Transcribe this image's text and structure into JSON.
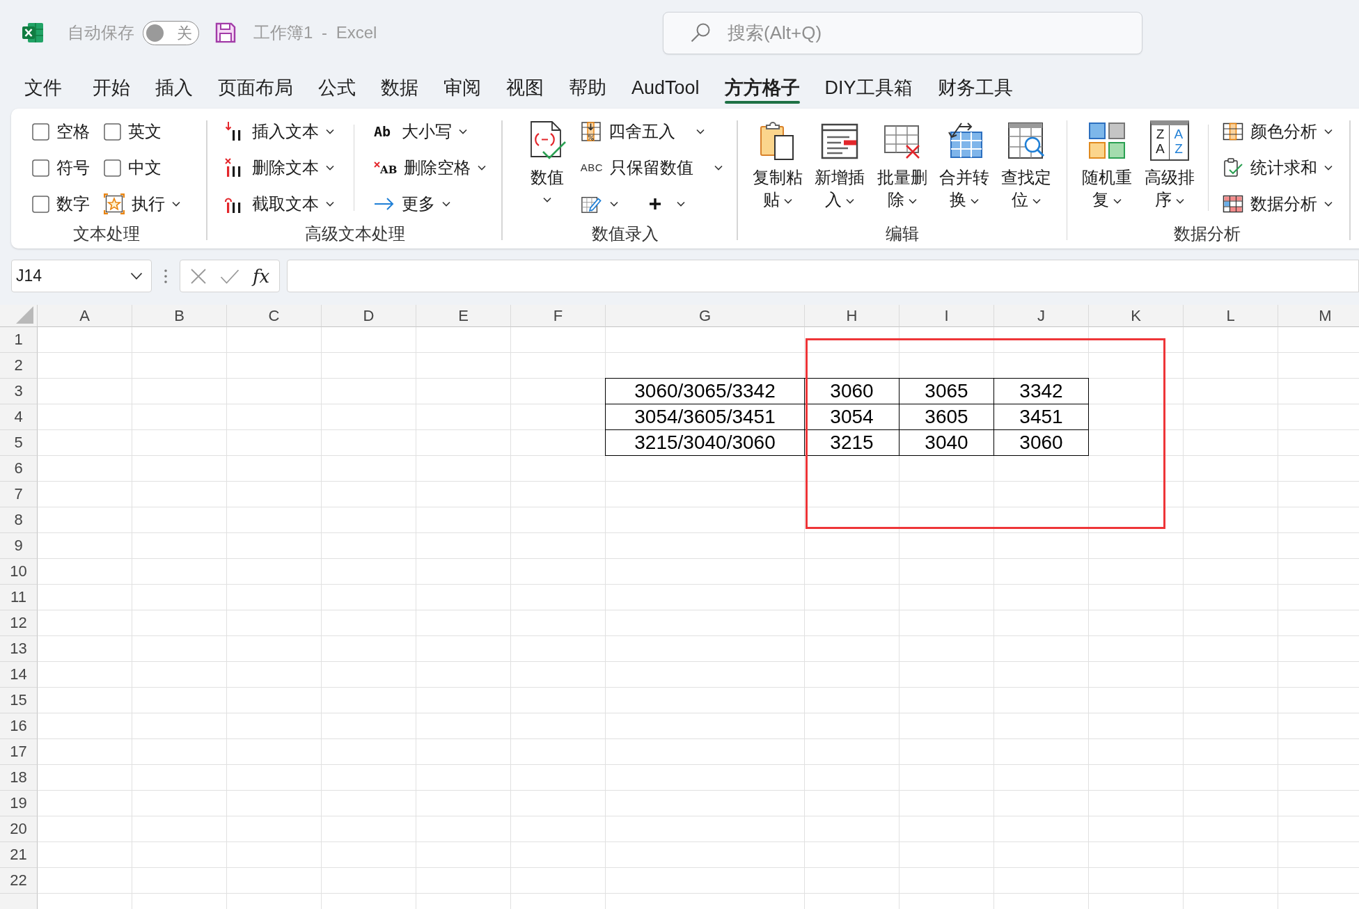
{
  "title_bar": {
    "autosave_label": "自动保存",
    "autosave_toggle": {
      "on": false,
      "label": "关"
    },
    "title": "工作簿1 - Excel",
    "search": {
      "placeholder": "搜索(Alt+Q)"
    }
  },
  "menu_tabs": [
    {
      "label": "文件",
      "selected": false
    },
    {
      "label": "开始",
      "selected": false
    },
    {
      "label": "插入",
      "selected": false
    },
    {
      "label": "页面布局",
      "selected": false
    },
    {
      "label": "公式",
      "selected": false
    },
    {
      "label": "数据",
      "selected": false
    },
    {
      "label": "审阅",
      "selected": false
    },
    {
      "label": "视图",
      "selected": false
    },
    {
      "label": "帮助",
      "selected": false
    },
    {
      "label": "AudTool",
      "selected": false
    },
    {
      "label": "方方格子",
      "selected": true
    },
    {
      "label": "DIY工具箱",
      "selected": false
    },
    {
      "label": "财务工具",
      "selected": false
    }
  ],
  "ribbon": {
    "groups": [
      {
        "label": "文本处理",
        "columns": [
          {
            "kind": "column",
            "items": [
              {
                "kind": "checkbox",
                "label": "空格",
                "checked": false
              },
              {
                "kind": "checkbox",
                "label": "符号",
                "checked": false
              },
              {
                "kind": "checkbox",
                "label": "数字",
                "checked": false
              }
            ]
          },
          {
            "kind": "column",
            "items": [
              {
                "kind": "checkbox",
                "label": "英文",
                "checked": false
              },
              {
                "kind": "checkbox",
                "label": "中文",
                "checked": false
              },
              {
                "kind": "menu",
                "label": "执行"
              }
            ]
          }
        ]
      },
      {
        "label": "高级文本处理",
        "columns": [
          {
            "kind": "column",
            "items": [
              {
                "kind": "menu",
                "label": "插入文本"
              },
              {
                "kind": "menu",
                "label": "删除文本"
              },
              {
                "kind": "menu",
                "label": "截取文本"
              }
            ]
          },
          {
            "kind": "divider"
          },
          {
            "kind": "column",
            "items": [
              {
                "kind": "menu",
                "label": "大小写",
                "icon_text": "Ab"
              },
              {
                "kind": "menu",
                "label": "删除空格",
                "icon_text": "AB"
              },
              {
                "kind": "menu",
                "label": "更多"
              }
            ]
          }
        ]
      },
      {
        "label": "数值录入",
        "columns": [
          {
            "kind": "column",
            "items": [
              {
                "kind": "large",
                "label": "数值"
              }
            ]
          },
          {
            "kind": "column",
            "items": [
              {
                "kind": "menu",
                "label": "四舍五入"
              },
              {
                "kind": "menu",
                "label": "只保留数值",
                "icon_text": "ABC"
              },
              {
                "kind": "icon-row",
                "buttons": [
                  {
                    "kind": "icon-menu"
                  },
                  {
                    "kind": "icon-menu"
                  }
                ]
              }
            ]
          }
        ]
      },
      {
        "label": "编辑",
        "columns": [
          {
            "kind": "column",
            "items": [
              {
                "kind": "large",
                "label": "复制粘贴"
              }
            ]
          },
          {
            "kind": "column",
            "items": [
              {
                "kind": "large",
                "label": "新增插入"
              }
            ]
          },
          {
            "kind": "column",
            "items": [
              {
                "kind": "large",
                "label": "批量删除"
              }
            ]
          },
          {
            "kind": "column",
            "items": [
              {
                "kind": "large",
                "label": "合并转换"
              }
            ]
          },
          {
            "kind": "column",
            "items": [
              {
                "kind": "large",
                "label": "查找定位"
              }
            ]
          }
        ]
      },
      {
        "label": "数据分析",
        "columns": [
          {
            "kind": "column",
            "items": [
              {
                "kind": "large",
                "label": "随机重复"
              }
            ]
          },
          {
            "kind": "column",
            "items": [
              {
                "kind": "large",
                "label": "高级排序",
                "icon_text": [
                  "ZA",
                  "AZ"
                ]
              }
            ]
          },
          {
            "kind": "divider"
          },
          {
            "kind": "column",
            "items": [
              {
                "kind": "menu",
                "label": "颜色分析"
              },
              {
                "kind": "menu",
                "label": "统计求和"
              },
              {
                "kind": "menu",
                "label": "数据分析"
              }
            ]
          }
        ]
      }
    ]
  },
  "formula_bar": {
    "name_box": "J14",
    "function_label": "fx"
  },
  "sheet": {
    "columns": [
      "A",
      "B",
      "C",
      "D",
      "E",
      "F",
      "G",
      "H",
      "I",
      "J",
      "K",
      "L",
      "M"
    ],
    "rows": [
      "1",
      "2",
      "3",
      "4",
      "5",
      "6",
      "7",
      "8",
      "9",
      "10",
      "11",
      "12",
      "13",
      "14",
      "15",
      "16",
      "17",
      "18",
      "19",
      "20",
      "21",
      "22"
    ],
    "table": [
      [
        "3060/3065/3342",
        "3060",
        "3065",
        "3342"
      ],
      [
        "3054/3605/3451",
        "3054",
        "3605",
        "3451"
      ],
      [
        "3215/3040/3060",
        "3215",
        "3040",
        "3060"
      ]
    ],
    "shapes": [
      {
        "kind": "rectangle"
      }
    ]
  }
}
